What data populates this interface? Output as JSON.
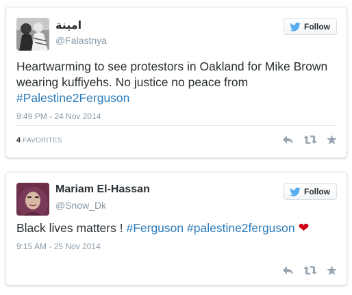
{
  "tweets": [
    {
      "name": "امينة",
      "handle": "@Falastnya",
      "follow_label": "Follow",
      "text": "Heartwarming to see protestors in Oakland for Mike Brown wearing kuffiyehs. No justice no peace from ",
      "hashtags": [
        "#Palestine2Ferguson"
      ],
      "timestamp": "9:49 PM - 24 Nov 2014",
      "favorites_count": "4",
      "favorites_label": "FAVORITES"
    },
    {
      "name": "Mariam El-Hassan",
      "handle": "@Snow_Dk",
      "follow_label": "Follow",
      "text": "Black lives matters ! ",
      "hashtags": [
        "#Ferguson",
        "#palestine2ferguson"
      ],
      "emoji": "❤",
      "timestamp": "9:15 AM - 25 Nov 2014"
    }
  ],
  "colors": {
    "hashtag": "#2b7bb9",
    "twitter_blue": "#55acee",
    "muted": "#8899a6",
    "heart": "#d0021b"
  },
  "icons": [
    "twitter-bird-icon",
    "reply-icon",
    "retweet-icon",
    "favorite-star-icon"
  ]
}
